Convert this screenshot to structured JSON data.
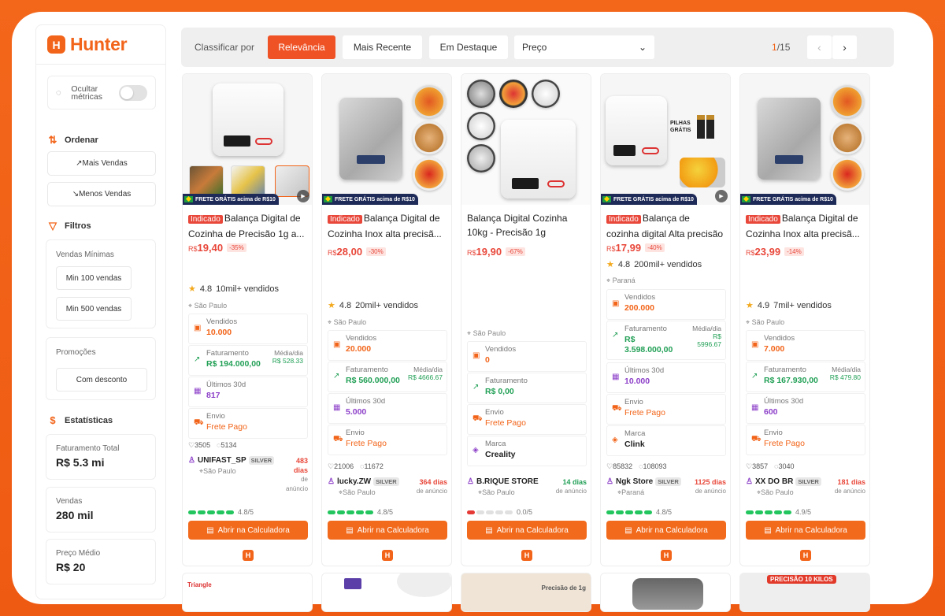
{
  "brand": {
    "name": "Hunter",
    "mark": "H",
    "color": "#f26419"
  },
  "sidebar": {
    "toggle_label": "Ocultar métricas",
    "order_title": "Ordenar",
    "order_buttons": [
      "↗Mais Vendas",
      "↘Menos Vendas"
    ],
    "filters_title": "Filtros",
    "min_sales_title": "Vendas Mínimas",
    "min_sales_buttons": [
      "Min 100 vendas",
      "Min 500 vendas"
    ],
    "promos_title": "Promoções",
    "promos_button": "Com desconto",
    "stats_title": "Estatísticas",
    "stats": [
      {
        "label": "Faturamento Total",
        "value": "R$ 5.3 mi"
      },
      {
        "label": "Vendas",
        "value": "280 mil"
      },
      {
        "label": "Preço Médio",
        "value": "R$ 20"
      }
    ]
  },
  "toolbar": {
    "sort_label": "Classificar por",
    "tabs": [
      "Relevância",
      "Mais Recente",
      "Em Destaque"
    ],
    "select_value": "Preço",
    "page_current": "1",
    "page_total": "/15"
  },
  "labels": {
    "vendidos": "Vendidos",
    "faturamento": "Faturamento",
    "media": "Média/dia",
    "ultimos": "Últimos 30d",
    "envio": "Envio",
    "marca": "Marca",
    "calc": "Abrir na Calculadora",
    "frete": "FRETE GRÁTIS acima de R$10",
    "dias_sub": "de anúncio",
    "pilhas": "PILHAS GRÁTIS",
    "precisao1": "Precisão de 1g",
    "precisao10": "PRECISÃO 10 KILOS",
    "triangle": "Triangle"
  },
  "products": [
    {
      "indicado": "Indicado",
      "title": "Balança Digital de Cozinha de Precisão 1g a...",
      "price": "19,40",
      "currency": "R$",
      "disc": "-35%",
      "rating": "4.8",
      "sold": "10mil+ vendidos",
      "loc": "São Paulo",
      "vendidos": "10.000",
      "faturamento": "R$ 194.000,00",
      "media": "R$ 528.33",
      "ultimos": "817",
      "envio": "Frete Pago",
      "likes": "3505",
      "comments": "5134",
      "seller": "UNIFAST_SP",
      "silver": "SILVER",
      "seller_loc": "São Paulo",
      "days": "483 dias",
      "score": "4.8/5"
    },
    {
      "indicado": "Indicado",
      "title": "Balança Digital de Cozinha Inox alta precisã...",
      "price": "28,00",
      "currency": "R$",
      "disc": "-30%",
      "rating": "4.8",
      "sold": "20mil+ vendidos",
      "loc": "São Paulo",
      "vendidos": "20.000",
      "faturamento": "R$ 560.000,00",
      "media": "R$ 4666.67",
      "ultimos": "5.000",
      "envio": "Frete Pago",
      "likes": "21006",
      "comments": "11672",
      "seller": "lucky.ZW",
      "silver": "SILVER",
      "seller_loc": "São Paulo",
      "days": "364 dias",
      "score": "4.8/5"
    },
    {
      "indicado": "",
      "title": "Balança Digital Cozinha 10kg - Precisão 1g",
      "price": "19,90",
      "currency": "R$",
      "disc": "-67%",
      "loc": "São Paulo",
      "vendidos": "0",
      "faturamento": "R$ 0,00",
      "envio": "Frete Pago",
      "marca": "Creality",
      "seller": "B.RIQUE STORE",
      "seller_loc": "São Paulo",
      "days": "14 dias",
      "score": "0.0/5"
    },
    {
      "indicado": "Indicado",
      "title": "Balança de cozinha digital Alta precisão com...",
      "price": "17,99",
      "currency": "R$",
      "disc": "-40%",
      "rating": "4.8",
      "sold": "200mil+ vendidos",
      "loc": "Paraná",
      "vendidos": "200.000",
      "faturamento": "R$ 3.598.000,00",
      "media": "R$ 5996.67",
      "ultimos": "10.000",
      "envio": "Frete Pago",
      "marca": "Clink",
      "likes": "85832",
      "comments": "108093",
      "seller": "Ngk Store",
      "silver": "SILVER",
      "seller_loc": "Paraná",
      "days": "1125 dias",
      "score": "4.8/5"
    },
    {
      "indicado": "Indicado",
      "title": "Balança Digital de Cozinha Inox alta precisã...",
      "price": "23,99",
      "currency": "R$",
      "disc": "-14%",
      "rating": "4.9",
      "sold": "7mil+ vendidos",
      "loc": "São Paulo",
      "vendidos": "7.000",
      "faturamento": "R$ 167.930,00",
      "media": "R$ 479.80",
      "ultimos": "600",
      "envio": "Frete Pago",
      "likes": "3857",
      "comments": "3040",
      "seller": "XX DO BR",
      "silver": "SILVER",
      "seller_loc": "São Paulo",
      "days": "181 dias",
      "score": "4.9/5"
    }
  ]
}
